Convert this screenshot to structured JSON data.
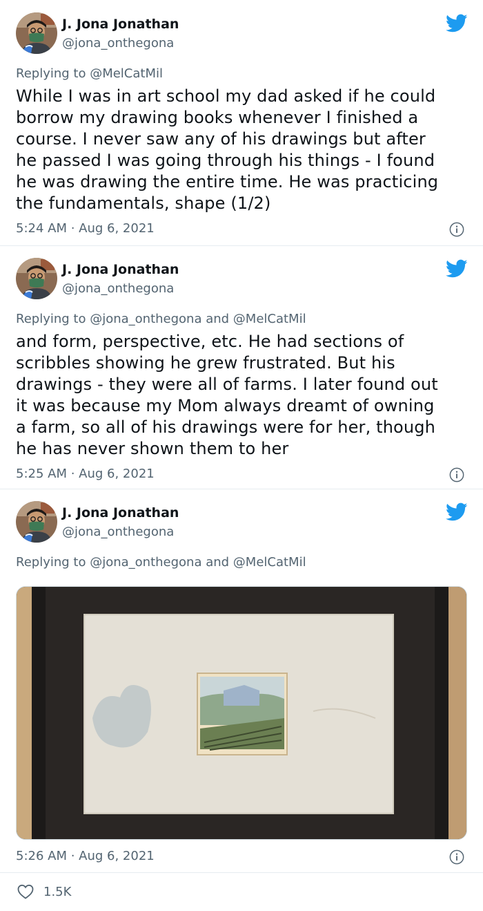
{
  "tweets": [
    {
      "author": {
        "name": "J. Jona Jonathan",
        "handle": "@jona_onthegona"
      },
      "replying_to": "Replying to @MelCatMil",
      "text_lines": [
        "While I was in art school my dad asked if he could",
        "borrow my drawing books whenever I finished a",
        "course.  I never saw any of his drawings but after",
        "he passed I was going through his things - I found",
        "he was drawing the entire time.  He was practicing",
        "the fundamentals, shape (1/2)"
      ],
      "timestamp": "5:24 AM · Aug 6, 2021"
    },
    {
      "author": {
        "name": "J. Jona Jonathan",
        "handle": "@jona_onthegona"
      },
      "replying_to": "Replying to @jona_onthegona and @MelCatMil",
      "text_lines": [
        "and form, perspective, etc.  He had sections of",
        "scribbles showing he grew frustrated.  But his",
        "drawings - they were all of farms.  I later found out",
        "it was because my Mom always dreamt of owning",
        "a farm, so all of his drawings were for her, though",
        "he has never shown them to her"
      ],
      "timestamp": "5:25 AM · Aug 6, 2021"
    },
    {
      "author": {
        "name": "J. Jona Jonathan",
        "handle": "@jona_onthegona"
      },
      "replying_to": "Replying to @jona_onthegona and @MelCatMil",
      "timestamp": "5:26 AM · Aug 6, 2021",
      "likes": "1.5K"
    }
  ],
  "colors": {
    "twitter_blue": "#1d9bf0",
    "secondary_text": "#536471",
    "divider": "#e6ecf0"
  },
  "icons": [
    "twitter-bird-icon",
    "info-icon",
    "heart-icon"
  ]
}
